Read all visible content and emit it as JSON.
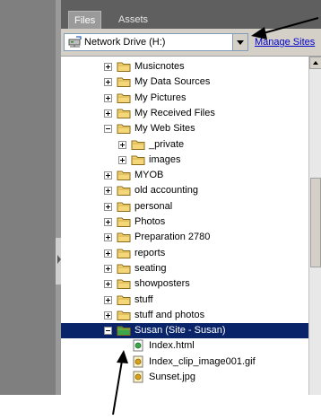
{
  "panel": {
    "tabs": [
      {
        "label": "Files",
        "active": true
      },
      {
        "label": "Assets",
        "active": false
      }
    ],
    "site_select": {
      "value": "Network Drive (H:)",
      "icon": "network-drive-icon"
    },
    "manage_sites_label": "Manage Sites"
  },
  "tree": {
    "items": [
      {
        "label": "Musicnotes",
        "type": "folder",
        "level": 0,
        "expander": "plus"
      },
      {
        "label": "My Data Sources",
        "type": "folder",
        "level": 0,
        "expander": "plus"
      },
      {
        "label": "My Pictures",
        "type": "folder",
        "level": 0,
        "expander": "plus"
      },
      {
        "label": "My Received Files",
        "type": "folder",
        "level": 0,
        "expander": "plus"
      },
      {
        "label": "My Web Sites",
        "type": "folder",
        "level": 0,
        "expander": "minus"
      },
      {
        "label": "_private",
        "type": "folder",
        "level": 1,
        "expander": "plus"
      },
      {
        "label": "images",
        "type": "folder",
        "level": 1,
        "expander": "plus"
      },
      {
        "label": "MYOB",
        "type": "folder",
        "level": 0,
        "expander": "plus"
      },
      {
        "label": "old accounting",
        "type": "folder",
        "level": 0,
        "expander": "plus"
      },
      {
        "label": "personal",
        "type": "folder",
        "level": 0,
        "expander": "plus"
      },
      {
        "label": "Photos",
        "type": "folder",
        "level": 0,
        "expander": "plus"
      },
      {
        "label": "Preparation 2780",
        "type": "folder",
        "level": 0,
        "expander": "plus"
      },
      {
        "label": "reports",
        "type": "folder",
        "level": 0,
        "expander": "plus"
      },
      {
        "label": "seating",
        "type": "folder",
        "level": 0,
        "expander": "plus"
      },
      {
        "label": "showposters",
        "type": "folder",
        "level": 0,
        "expander": "plus"
      },
      {
        "label": "stuff",
        "type": "folder",
        "level": 0,
        "expander": "plus"
      },
      {
        "label": "stuff and photos",
        "type": "folder",
        "level": 0,
        "expander": "plus"
      },
      {
        "label": "Susan (Site - Susan)",
        "type": "site",
        "level": 0,
        "expander": "minus",
        "selected": true
      },
      {
        "label": "Index.html",
        "type": "html-file",
        "level": 1,
        "expander": "none"
      },
      {
        "label": "Index_clip_image001.gif",
        "type": "image-file",
        "level": 1,
        "expander": "none"
      },
      {
        "label": "Sunset.jpg",
        "type": "image-file",
        "level": 1,
        "expander": "none"
      }
    ]
  },
  "colors": {
    "selection": "#0a246a",
    "folder": "#f5d77a",
    "site_folder": "#3aa84a",
    "link": "#0000cc"
  }
}
